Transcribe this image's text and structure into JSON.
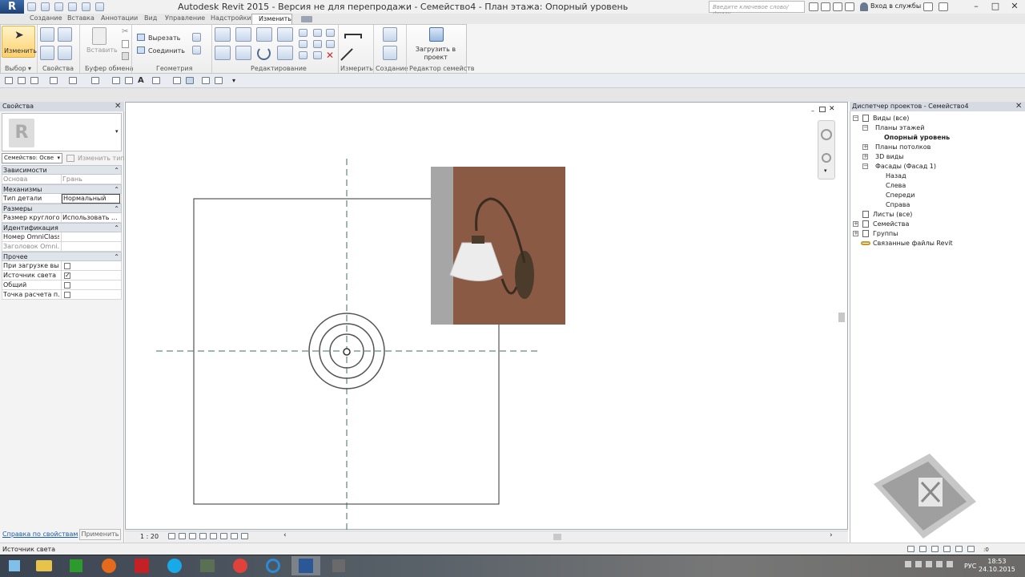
{
  "app": {
    "title": "Autodesk Revit 2015 -  Версия не для перепродажи -     Семейство4 - План этажа: Опорный уровень",
    "search_placeholder": "Введите ключевое слово/фразу",
    "login_label": "Вход в службы",
    "logo_letter": "R"
  },
  "tabs": [
    "Создание",
    "Вставка",
    "Аннотации",
    "Вид",
    "Управление",
    "Надстройки"
  ],
  "active_tab": "Изменить",
  "ribbon": {
    "modify_label": "Изменить",
    "select_label": "Выбор",
    "panels": [
      "Свойства",
      "Буфер обмена",
      "Геометрия",
      "Редактирование",
      "Измерить",
      "Создание",
      "Редактор семейств"
    ],
    "paste_label": "Вставить",
    "cut_label": "Вырезать",
    "join_label": "Соединить",
    "load_label": "Загрузить в проект"
  },
  "properties": {
    "title": "Свойства",
    "family_select": "Семейство: Осве",
    "edit_type": "Изменить тип",
    "groups": {
      "constraints": "Зависимости",
      "mechanisms": "Механизмы",
      "dimensions": "Размеры",
      "identity": "Идентификация",
      "other": "Прочее"
    },
    "rows": {
      "host": {
        "name": "Основа",
        "value": "Грань"
      },
      "part_type": {
        "name": "Тип детали",
        "value": "Нормальный"
      },
      "round_size": {
        "name": "Размер круглого...",
        "value": "Использовать ..."
      },
      "omniclass_num": {
        "name": "Номер OmniClass",
        "value": ""
      },
      "omniclass_title": {
        "name": "Заголовок Omni...",
        "value": ""
      },
      "on_load": {
        "name": "При загрузке вы...",
        "checked": false
      },
      "light_source": {
        "name": "Источник света",
        "checked": true
      },
      "shared": {
        "name": "Общий",
        "checked": false
      },
      "calc_point": {
        "name": "Точка расчета п...",
        "checked": false
      }
    },
    "help_link": "Справка по свойствам",
    "apply_button": "Применить"
  },
  "view": {
    "scale": "1 : 20"
  },
  "browser": {
    "title": "Диспетчер проектов - Семейство4",
    "views_all": "Виды (все)",
    "floor_plans": "Планы этажей",
    "ref_level": "Опорный уровень",
    "ceiling_plans": "Планы потолков",
    "views_3d": "3D виды",
    "elevations": "Фасады (Фасад 1)",
    "back": "Назад",
    "left": "Слева",
    "front": "Спереди",
    "right": "Справа",
    "sheets": "Листы (все)",
    "families": "Семейства",
    "groups": "Группы",
    "links": "Связанные файлы Revit"
  },
  "status": {
    "text": "Источник света",
    "filter_count": ":0"
  },
  "taskbar": {
    "lang": "РУС",
    "time": "18:53",
    "date": "24.10.2015"
  },
  "colors": {
    "accent_blue": "#1a5ca8",
    "plan_line": "#333333",
    "ref_plane": "#3c6e5a",
    "wall_brown": "#8a5a45"
  }
}
